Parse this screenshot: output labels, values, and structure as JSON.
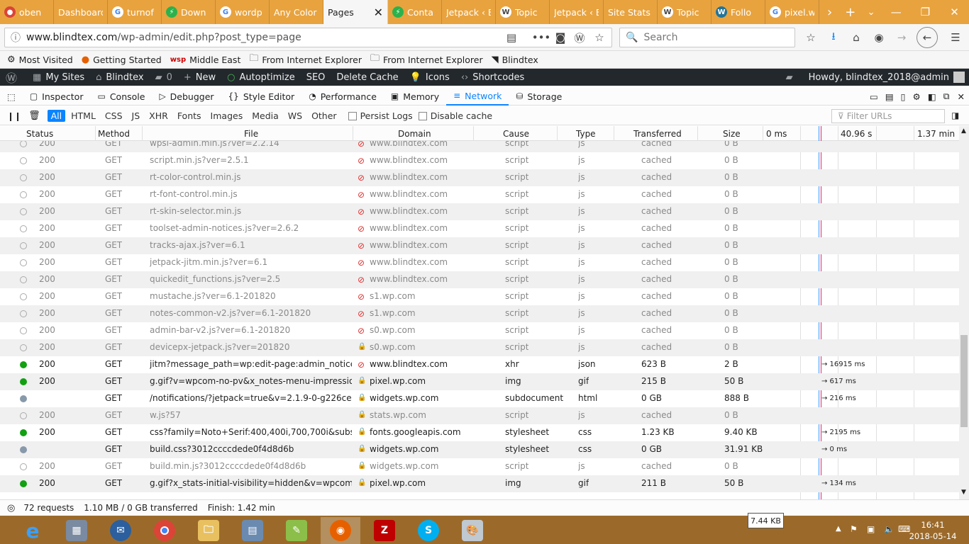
{
  "browser": {
    "tabs": [
      {
        "title": "oben",
        "icon": "chrome-icon"
      },
      {
        "title": "Dashboard",
        "icon": "none"
      },
      {
        "title": "turnof",
        "icon": "google-icon"
      },
      {
        "title": "Down",
        "icon": "green-icon"
      },
      {
        "title": "wordp",
        "icon": "google-icon"
      },
      {
        "title": "Any Color",
        "icon": "none"
      },
      {
        "title": "Pages",
        "icon": "none",
        "active": true
      },
      {
        "title": "Conta",
        "icon": "green-icon"
      },
      {
        "title": "Jetpack ‹ B",
        "icon": "none"
      },
      {
        "title": "Topic",
        "icon": "wp-icon"
      },
      {
        "title": "Jetpack ‹ B",
        "icon": "none"
      },
      {
        "title": "Site Stats ‹",
        "icon": "none"
      },
      {
        "title": "Topic",
        "icon": "wp-icon"
      },
      {
        "title": "Follo",
        "icon": "wp-blue-icon"
      },
      {
        "title": "pixel.w",
        "icon": "google-icon"
      }
    ],
    "url_host": "www.blindtex.com",
    "url_path": "/wp-admin/edit.php?post_type=page",
    "search_placeholder": "Search",
    "bookmarks": [
      "Most Visited",
      "Getting Started",
      "Middle East",
      "From Internet Explorer",
      "From Internet Explorer",
      "Blindtex"
    ]
  },
  "wpbar": {
    "items": [
      "My Sites",
      "Blindtex",
      "0",
      "New",
      "Autoptimize",
      "SEO",
      "Delete Cache",
      "Icons",
      "Shortcodes"
    ],
    "howdy": "Howdy, blindtex_2018@admin"
  },
  "devtools": {
    "tools": [
      "Inspector",
      "Console",
      "Debugger",
      "Style Editor",
      "Performance",
      "Memory",
      "Network",
      "Storage"
    ],
    "filters": [
      "All",
      "HTML",
      "CSS",
      "JS",
      "XHR",
      "Fonts",
      "Images",
      "Media",
      "WS",
      "Other"
    ],
    "persist": "Persist Logs",
    "disable_cache": "Disable cache",
    "filter_placeholder": "Filter URLs",
    "columns": [
      "Status",
      "Method",
      "File",
      "Domain",
      "Cause",
      "Type",
      "Transferred",
      "Size",
      "0 ms",
      "40.96 s",
      "1.37 min"
    ],
    "rows": [
      {
        "status": "200",
        "method": "GET",
        "file": "wpsl-admin.min.js?ver=2.2.14",
        "domain": "www.blindtex.com",
        "cause": "script",
        "type": "js",
        "transferred": "cached",
        "size": "0 B",
        "kind": "cache",
        "lock": "broken",
        "wf": ""
      },
      {
        "status": "200",
        "method": "GET",
        "file": "script.min.js?ver=2.5.1",
        "domain": "www.blindtex.com",
        "cause": "script",
        "type": "js",
        "transferred": "cached",
        "size": "0 B",
        "kind": "cache",
        "lock": "broken",
        "wf": ""
      },
      {
        "status": "200",
        "method": "GET",
        "file": "rt-color-control.min.js",
        "domain": "www.blindtex.com",
        "cause": "script",
        "type": "js",
        "transferred": "cached",
        "size": "0 B",
        "kind": "cache",
        "lock": "broken",
        "wf": ""
      },
      {
        "status": "200",
        "method": "GET",
        "file": "rt-font-control.min.js",
        "domain": "www.blindtex.com",
        "cause": "script",
        "type": "js",
        "transferred": "cached",
        "size": "0 B",
        "kind": "cache",
        "lock": "broken",
        "wf": ""
      },
      {
        "status": "200",
        "method": "GET",
        "file": "rt-skin-selector.min.js",
        "domain": "www.blindtex.com",
        "cause": "script",
        "type": "js",
        "transferred": "cached",
        "size": "0 B",
        "kind": "cache",
        "lock": "broken",
        "wf": ""
      },
      {
        "status": "200",
        "method": "GET",
        "file": "toolset-admin-notices.js?ver=2.6.2",
        "domain": "www.blindtex.com",
        "cause": "script",
        "type": "js",
        "transferred": "cached",
        "size": "0 B",
        "kind": "cache",
        "lock": "broken",
        "wf": ""
      },
      {
        "status": "200",
        "method": "GET",
        "file": "tracks-ajax.js?ver=6.1",
        "domain": "www.blindtex.com",
        "cause": "script",
        "type": "js",
        "transferred": "cached",
        "size": "0 B",
        "kind": "cache",
        "lock": "broken",
        "wf": ""
      },
      {
        "status": "200",
        "method": "GET",
        "file": "jetpack-jitm.min.js?ver=6.1",
        "domain": "www.blindtex.com",
        "cause": "script",
        "type": "js",
        "transferred": "cached",
        "size": "0 B",
        "kind": "cache",
        "lock": "broken",
        "wf": ""
      },
      {
        "status": "200",
        "method": "GET",
        "file": "quickedit_functions.js?ver=2.5",
        "domain": "www.blindtex.com",
        "cause": "script",
        "type": "js",
        "transferred": "cached",
        "size": "0 B",
        "kind": "cache",
        "lock": "broken",
        "wf": ""
      },
      {
        "status": "200",
        "method": "GET",
        "file": "mustache.js?ver=6.1-201820",
        "domain": "s1.wp.com",
        "cause": "script",
        "type": "js",
        "transferred": "cached",
        "size": "0 B",
        "kind": "cache",
        "lock": "broken",
        "wf": ""
      },
      {
        "status": "200",
        "method": "GET",
        "file": "notes-common-v2.js?ver=6.1-201820",
        "domain": "s1.wp.com",
        "cause": "script",
        "type": "js",
        "transferred": "cached",
        "size": "0 B",
        "kind": "cache",
        "lock": "broken",
        "wf": ""
      },
      {
        "status": "200",
        "method": "GET",
        "file": "admin-bar-v2.js?ver=6.1-201820",
        "domain": "s0.wp.com",
        "cause": "script",
        "type": "js",
        "transferred": "cached",
        "size": "0 B",
        "kind": "cache",
        "lock": "broken",
        "wf": ""
      },
      {
        "status": "200",
        "method": "GET",
        "file": "devicepx-jetpack.js?ver=201820",
        "domain": "s0.wp.com",
        "cause": "script",
        "type": "js",
        "transferred": "cached",
        "size": "0 B",
        "kind": "cache",
        "lock": "secure",
        "wf": ""
      },
      {
        "status": "200",
        "method": "GET",
        "file": "jitm?message_path=wp:edit-page:admin_notices&q...",
        "domain": "www.blindtex.com",
        "cause": "xhr",
        "type": "json",
        "transferred": "623 B",
        "size": "2 B",
        "kind": "ok",
        "lock": "broken",
        "wf": "→ 16915 ms"
      },
      {
        "status": "200",
        "method": "GET",
        "file": "g.gif?v=wpcom-no-pv&x_notes-menu-impressions...",
        "domain": "pixel.wp.com",
        "cause": "img",
        "type": "gif",
        "transferred": "215 B",
        "size": "50 B",
        "kind": "ok",
        "lock": "secure",
        "wf": "→ 617 ms"
      },
      {
        "status": "",
        "method": "GET",
        "file": "/notifications/?jetpack=true&v=2.1.9-0-g226ce43&l...",
        "domain": "widgets.wp.com",
        "cause": "subdocument",
        "type": "html",
        "transferred": "0 GB",
        "size": "888 B",
        "kind": "gray",
        "lock": "secure",
        "wf": "→ 216 ms"
      },
      {
        "status": "200",
        "method": "GET",
        "file": "w.js?57",
        "domain": "stats.wp.com",
        "cause": "script",
        "type": "js",
        "transferred": "cached",
        "size": "0 B",
        "kind": "cache",
        "lock": "secure",
        "wf": ""
      },
      {
        "status": "200",
        "method": "GET",
        "file": "css?family=Noto+Serif:400,400i,700,700i&subset=cy...",
        "domain": "fonts.googleapis.com",
        "cause": "stylesheet",
        "type": "css",
        "transferred": "1.23 KB",
        "size": "9.40 KB",
        "kind": "ok",
        "lock": "secure",
        "wf": "→ 2195 ms"
      },
      {
        "status": "",
        "method": "GET",
        "file": "build.css?3012ccccdede0f4d8d6b",
        "domain": "widgets.wp.com",
        "cause": "stylesheet",
        "type": "css",
        "transferred": "0 GB",
        "size": "31.91 KB",
        "kind": "gray",
        "lock": "secure",
        "wf": "→ 0 ms"
      },
      {
        "status": "200",
        "method": "GET",
        "file": "build.min.js?3012ccccdede0f4d8d6b",
        "domain": "widgets.wp.com",
        "cause": "script",
        "type": "js",
        "transferred": "cached",
        "size": "0 B",
        "kind": "cache",
        "lock": "secure",
        "wf": ""
      },
      {
        "status": "200",
        "method": "GET",
        "file": "g.gif?x_stats-initial-visibility=hidden&v=wpcom-no...",
        "domain": "pixel.wp.com",
        "cause": "img",
        "type": "gif",
        "transferred": "211 B",
        "size": "50 B",
        "kind": "ok",
        "lock": "secure",
        "wf": "→ 134 ms"
      }
    ],
    "summary": {
      "requests": "72 requests",
      "transferred": "1.10 MB / 0 GB transferred",
      "finish": "Finish: 1.42 min"
    },
    "tooltip": "7.44 KB"
  },
  "taskbar": {
    "time": "16:41",
    "date": "2018-05-14"
  }
}
